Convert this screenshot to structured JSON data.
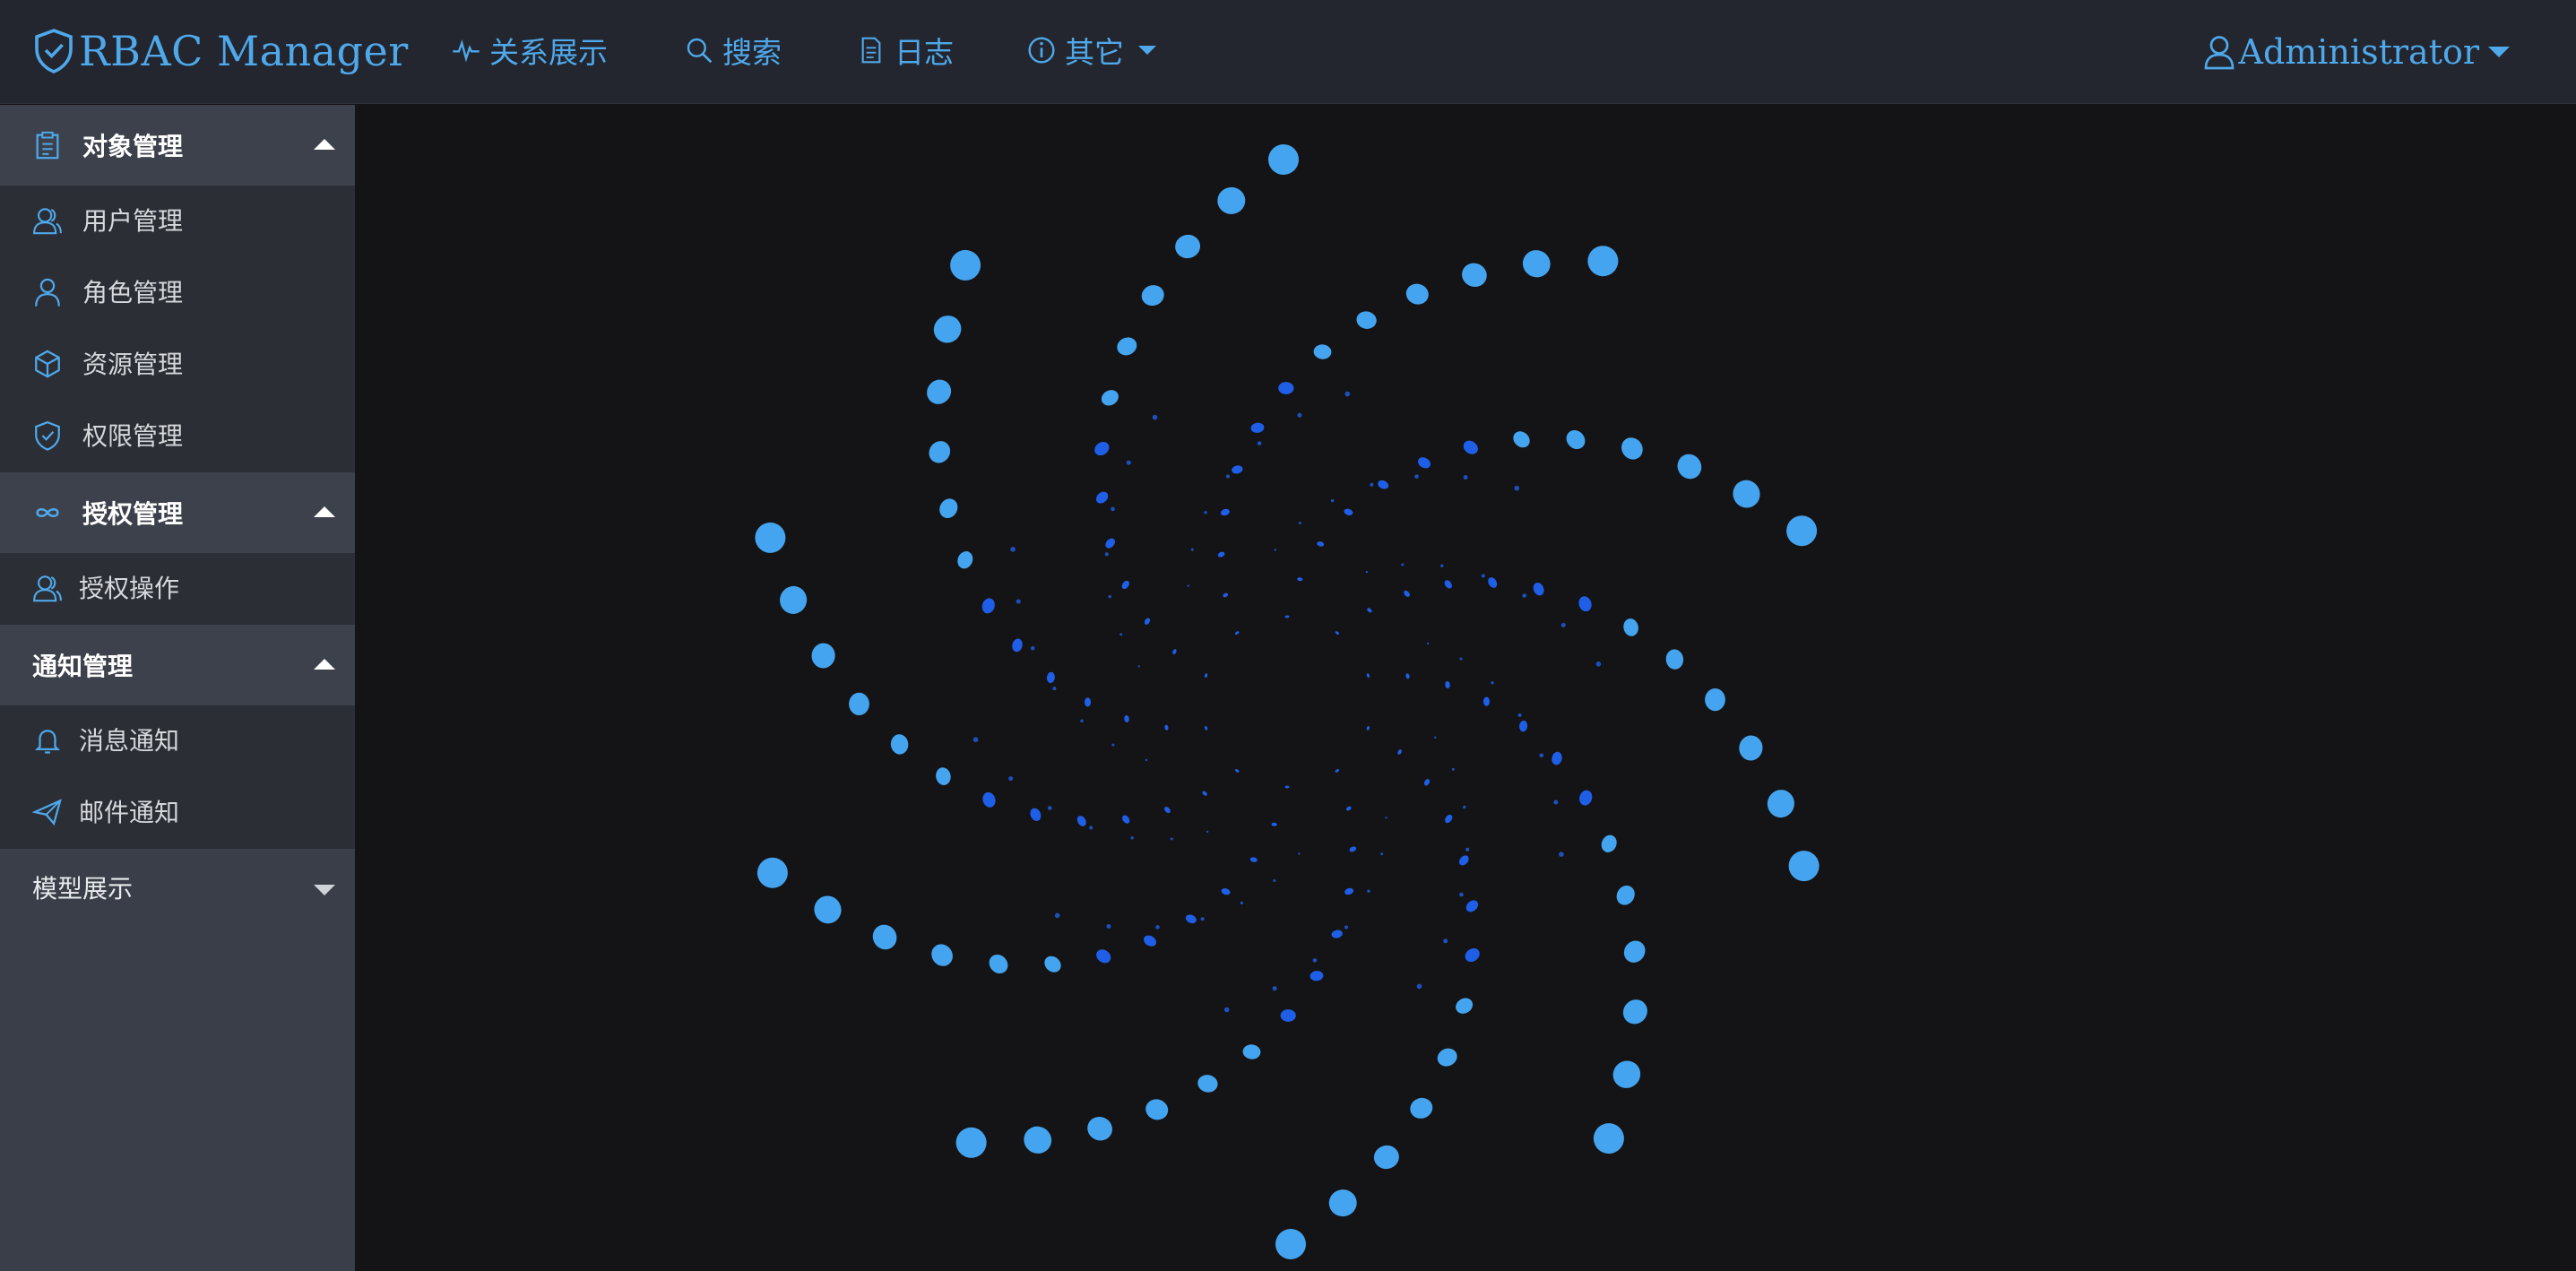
{
  "app": {
    "title": "RBAC Manager",
    "user": "Administrator"
  },
  "nav": {
    "items": [
      {
        "label": "关系展示",
        "icon": "pulse-icon"
      },
      {
        "label": "搜索",
        "icon": "search-icon"
      },
      {
        "label": "日志",
        "icon": "document-icon"
      },
      {
        "label": "其它",
        "icon": "info-icon",
        "has_dropdown": true
      }
    ]
  },
  "sidebar": {
    "groups": [
      {
        "label": "对象管理",
        "icon": "clipboard-icon",
        "expanded": true,
        "items": [
          {
            "label": "用户管理",
            "icon": "users-icon"
          },
          {
            "label": "角色管理",
            "icon": "user-icon"
          },
          {
            "label": "资源管理",
            "icon": "cube-icon"
          },
          {
            "label": "权限管理",
            "icon": "shield-check-icon"
          }
        ]
      },
      {
        "label": "授权管理",
        "icon": "infinity-icon",
        "expanded": true,
        "items": [
          {
            "label": "授权操作",
            "icon": "users-icon"
          }
        ]
      },
      {
        "label": "通知管理",
        "expanded": true,
        "items": [
          {
            "label": "消息通知",
            "icon": "bell-icon"
          },
          {
            "label": "邮件通知",
            "icon": "paper-plane-icon"
          }
        ]
      },
      {
        "label": "模型展示",
        "expanded": false,
        "items": []
      }
    ]
  },
  "colors": {
    "accent": "#4fa8ea",
    "topbar_bg": "#23262e",
    "sidebar_bg": "#3a3e48",
    "submenu_bg": "#2b2e35",
    "content_bg": "#141416",
    "spinner_outer": "#45a4ef",
    "spinner_inner": "#1f5fe8"
  },
  "loading_spinner": {
    "arms": 10,
    "visible": true
  }
}
